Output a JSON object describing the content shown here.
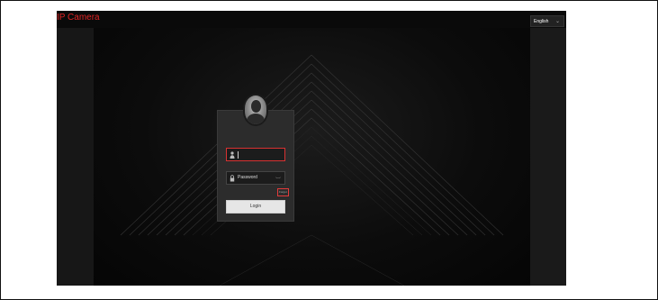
{
  "app": {
    "logo_text": "IP Camera"
  },
  "header": {
    "language_selected": "English"
  },
  "login": {
    "username_value": "",
    "password_placeholder": "Password",
    "forgot_link": "Forgot",
    "login_label": "Login"
  },
  "colors": {
    "brand_red": "#e02424",
    "background": "#050505",
    "card": "#2c2c2c",
    "field_highlight": "#d83232",
    "button": "#e6e6e6"
  },
  "icons": {
    "user": "user-icon",
    "lock": "lock-icon",
    "eye": "eye-icon",
    "dropdown": "chevron-down-icon",
    "avatar": "avatar-icon"
  }
}
